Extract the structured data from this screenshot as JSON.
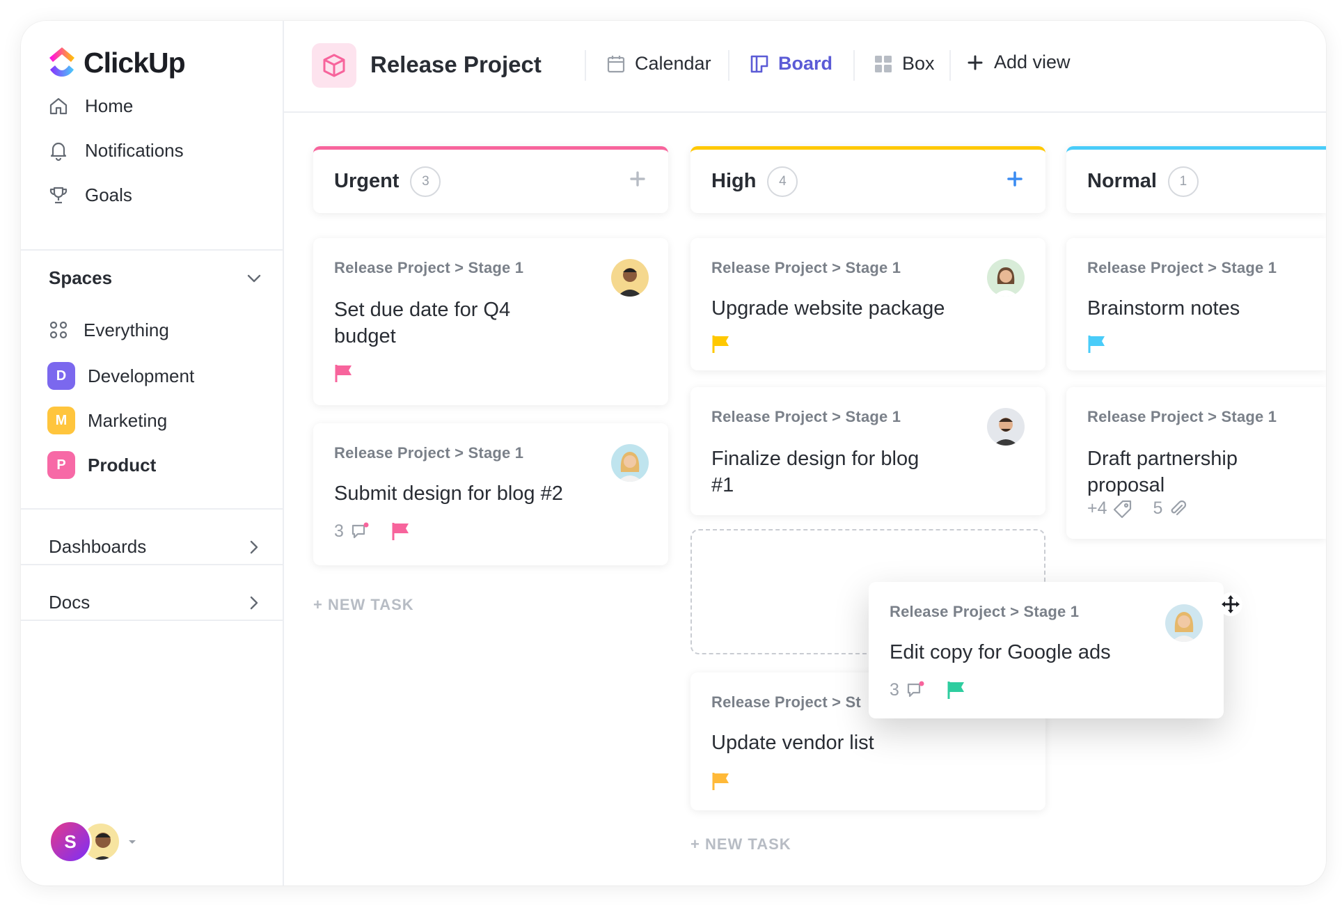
{
  "app": {
    "name": "ClickUp"
  },
  "sidebar": {
    "nav": [
      {
        "label": "Home",
        "icon": "home-icon"
      },
      {
        "label": "Notifications",
        "icon": "bell-icon"
      },
      {
        "label": "Goals",
        "icon": "trophy-icon"
      }
    ],
    "spaces_label": "Spaces",
    "everything_label": "Everything",
    "spaces": [
      {
        "badge": "D",
        "label": "Development",
        "color": "#7b68ee"
      },
      {
        "badge": "M",
        "label": "Marketing",
        "color": "#ffc53d"
      },
      {
        "badge": "P",
        "label": "Product",
        "color": "#f769a6"
      }
    ],
    "dashboards_label": "Dashboards",
    "docs_label": "Docs",
    "user_initial": "S"
  },
  "header": {
    "project_title": "Release Project",
    "views": [
      {
        "label": "Calendar",
        "icon": "calendar-icon"
      },
      {
        "label": "Board",
        "icon": "board-icon",
        "active": true
      },
      {
        "label": "Box",
        "icon": "box-grid-icon"
      },
      {
        "label": "Add view",
        "icon": "plus-icon"
      }
    ]
  },
  "board": {
    "columns": [
      {
        "title": "Urgent",
        "count": "3",
        "color": "#f7649c"
      },
      {
        "title": "High",
        "count": "4",
        "color": "#ffc800"
      },
      {
        "title": "Normal",
        "count": "1",
        "color": "#49ccf9"
      }
    ],
    "new_task_label": "+ NEW TASK",
    "cards": {
      "u1": {
        "crumb": "Release Project > Stage 1",
        "title": "Set due date for Q4 budget",
        "flag_color": "#f7649c"
      },
      "u2": {
        "crumb": "Release Project > Stage 1",
        "title": "Submit design for blog #2",
        "comments": "3",
        "flag_color": "#f7649c"
      },
      "h1": {
        "crumb": "Release Project > Stage 1",
        "title": "Upgrade website package",
        "flag_color": "#ffc800"
      },
      "h2": {
        "crumb": "Release Project > Stage 1",
        "title": "Finalize design for blog #1"
      },
      "h3": {
        "crumb": "Release Project > St",
        "title": "Update vendor list",
        "flag_color": "#ffb938"
      },
      "n1": {
        "crumb": "Release Project > Stage 1",
        "title": "Brainstorm notes",
        "flag_color": "#49ccf9"
      },
      "n2": {
        "crumb": "Release Project > Stage 1",
        "title": "Draft partnership proposal",
        "tags": "+4",
        "attachments": "5"
      },
      "drag": {
        "crumb": "Release Project > Stage 1",
        "title": "Edit copy for Google ads",
        "comments": "3",
        "flag_color": "#2ecd9f"
      }
    }
  }
}
